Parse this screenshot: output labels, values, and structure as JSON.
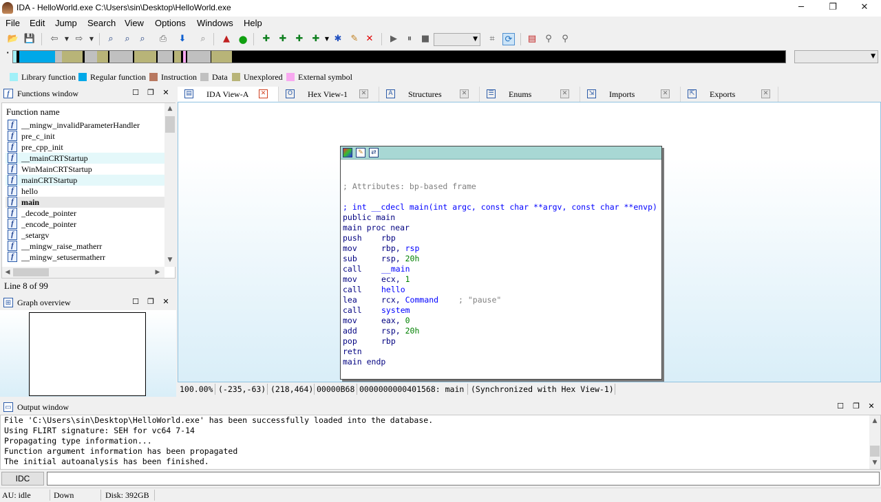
{
  "window": {
    "title": "IDA - HelloWorld.exe C:\\Users\\sin\\Desktop\\HelloWorld.exe",
    "minimize_glyph": "─",
    "restore_glyph": "❐",
    "close_glyph": "✕"
  },
  "menu": [
    "File",
    "Edit",
    "Jump",
    "Search",
    "View",
    "Options",
    "Windows",
    "Help"
  ],
  "legend": [
    {
      "label": "Library function",
      "color": "#a0f0f8"
    },
    {
      "label": "Regular function",
      "color": "#00a8e8"
    },
    {
      "label": "Instruction",
      "color": "#b87860"
    },
    {
      "label": "Data",
      "color": "#c0c0c0"
    },
    {
      "label": "Unexplored",
      "color": "#b8b478"
    },
    {
      "label": "External symbol",
      "color": "#f8a8f0"
    }
  ],
  "functions_window": {
    "title": "Functions window",
    "column_header": "Function name",
    "functions": [
      "__mingw_invalidParameterHandler",
      "pre_c_init",
      "pre_cpp_init",
      "__tmainCRTStartup",
      "WinMainCRTStartup",
      "mainCRTStartup",
      "hello",
      "main",
      "_decode_pointer",
      "_encode_pointer",
      "_setargv",
      "__mingw_raise_matherr",
      "__mingw_setusermatherr"
    ],
    "selected_index": 7,
    "status": "Line 8 of 99"
  },
  "graph_overview": {
    "title": "Graph overview"
  },
  "tabs": [
    {
      "label": "IDA View-A",
      "icon": "ida-view-icon",
      "active": true
    },
    {
      "label": "Hex View-1",
      "icon": "hex-view-icon",
      "active": false
    },
    {
      "label": "Structures",
      "icon": "structures-icon",
      "active": false
    },
    {
      "label": "Enums",
      "icon": "enums-icon",
      "active": false
    },
    {
      "label": "Imports",
      "icon": "imports-icon",
      "active": false
    },
    {
      "label": "Exports",
      "icon": "exports-icon",
      "active": false
    }
  ],
  "disassembly": {
    "attributes_comment": "; Attributes: bp-based frame",
    "signature": "; int __cdecl main(int argc, const char **argv, const char **envp)",
    "public": "public main",
    "proc": "main proc near",
    "instructions": [
      {
        "mnemonic": "push",
        "operand": "rbp",
        "comment": ""
      },
      {
        "mnemonic": "mov",
        "operand": "rbp, rsp",
        "comment": ""
      },
      {
        "mnemonic": "sub",
        "operand": "rsp, 20h",
        "comment": ""
      },
      {
        "mnemonic": "call",
        "operand": "__main",
        "comment": ""
      },
      {
        "mnemonic": "mov",
        "operand": "ecx, 1",
        "comment": ""
      },
      {
        "mnemonic": "call",
        "operand": "hello",
        "comment": ""
      },
      {
        "mnemonic": "lea",
        "operand": "rcx, Command",
        "comment": "; \"pause\""
      },
      {
        "mnemonic": "call",
        "operand": "system",
        "comment": ""
      },
      {
        "mnemonic": "mov",
        "operand": "eax, 0",
        "comment": ""
      },
      {
        "mnemonic": "add",
        "operand": "rsp, 20h",
        "comment": ""
      },
      {
        "mnemonic": "pop",
        "operand": "rbp",
        "comment": ""
      },
      {
        "mnemonic": "retn",
        "operand": "",
        "comment": ""
      }
    ],
    "endp": "main endp"
  },
  "graph_status": {
    "zoom": "100.00%",
    "mouse_pos": "(-235,-63)",
    "node_pos": "(218,464)",
    "file_offset": "00000B68",
    "address": "0000000000401568: main",
    "sync": "(Synchronized with Hex View-1)"
  },
  "output_window": {
    "title": "Output window",
    "lines": [
      "File 'C:\\Users\\sin\\Desktop\\HelloWorld.exe' has been successfully loaded into the database.",
      "Using FLIRT signature: SEH for vc64 7-14",
      "Propagating type information...",
      "Function argument information has been propagated",
      "The initial autoanalysis has been finished."
    ]
  },
  "command_bar": {
    "language": "IDC",
    "value": ""
  },
  "status_bar": {
    "au": "AU:  idle",
    "direction": "Down",
    "disk": "Disk: 392GB"
  }
}
